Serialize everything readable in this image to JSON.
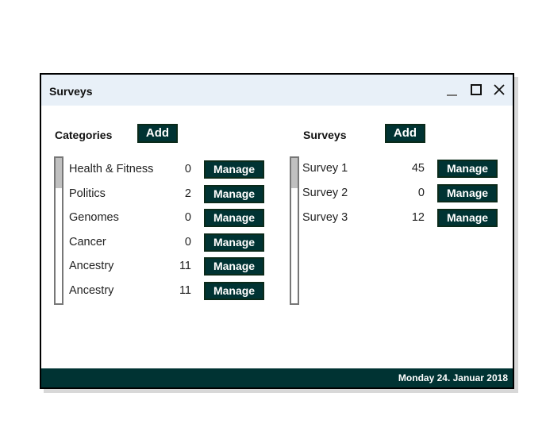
{
  "window": {
    "title": "Surveys",
    "minimize_icon": "minimize-icon",
    "maximize_icon": "maximize-icon",
    "close_icon": "close-icon"
  },
  "categories": {
    "heading": "Categories",
    "add_label": "Add",
    "items": [
      {
        "name": "Health & Fitness",
        "count": "0",
        "action": "Manage"
      },
      {
        "name": "Politics",
        "count": "2",
        "action": "Manage"
      },
      {
        "name": "Genomes",
        "count": "0",
        "action": "Manage"
      },
      {
        "name": "Cancer",
        "count": "0",
        "action": "Manage"
      },
      {
        "name": "Ancestry",
        "count": "11",
        "action": "Manage"
      },
      {
        "name": "Ancestry",
        "count": "11",
        "action": "Manage"
      }
    ]
  },
  "surveys": {
    "heading": "Surveys",
    "add_label": "Add",
    "items": [
      {
        "name": "Survey 1",
        "count": "45",
        "action": "Manage"
      },
      {
        "name": "Survey 2",
        "count": "0",
        "action": "Manage"
      },
      {
        "name": "Survey 3",
        "count": "12",
        "action": "Manage"
      }
    ]
  },
  "footer": {
    "date": "Monday 24. Januar 2018"
  },
  "colors": {
    "accent": "#003333",
    "titlebar": "#e8f0f8"
  }
}
